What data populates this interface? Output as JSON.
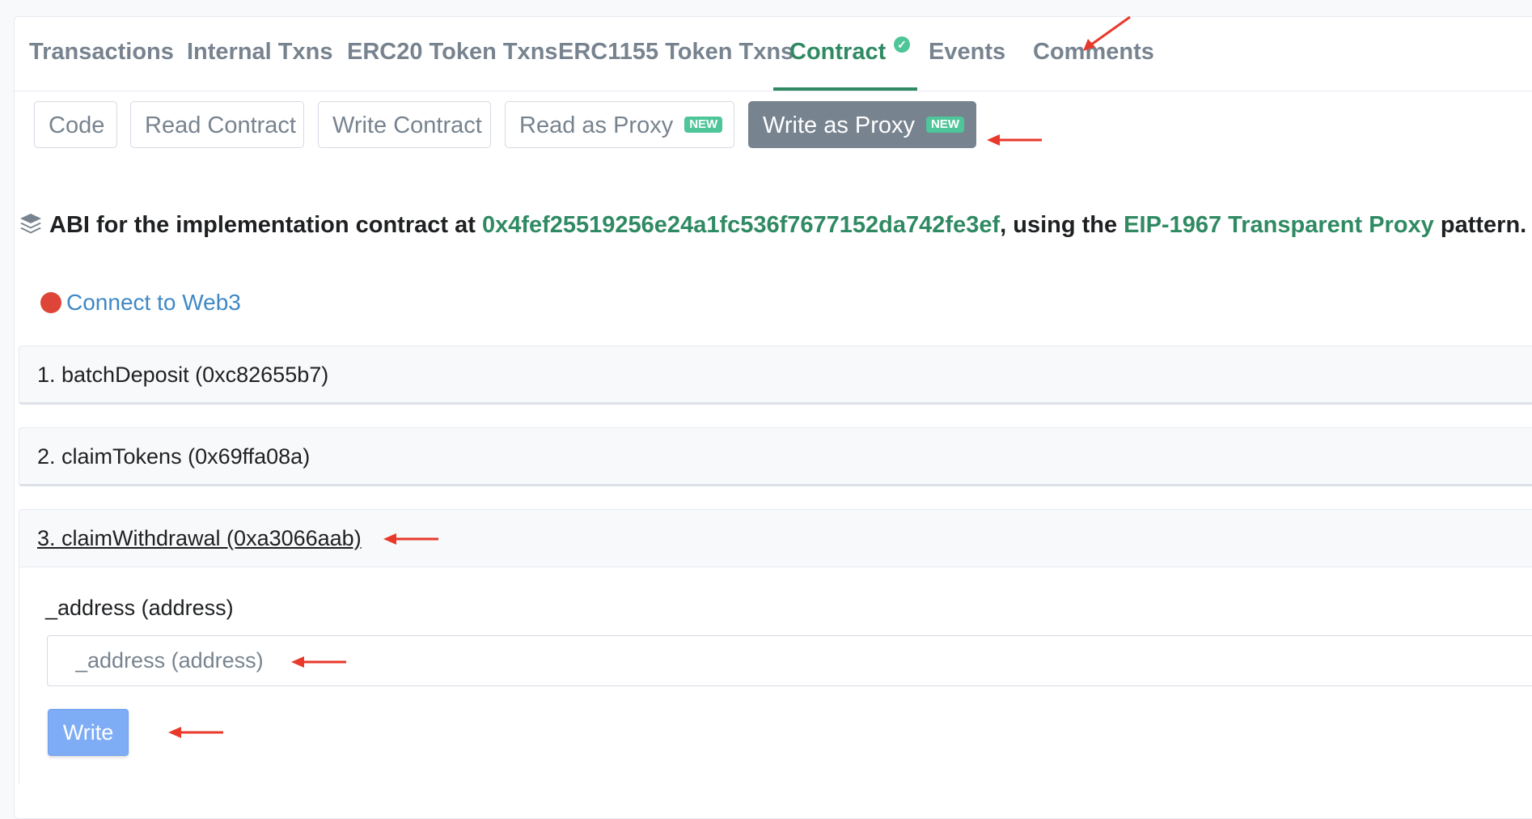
{
  "tabs": [
    {
      "label": "Transactions"
    },
    {
      "label": "Internal Txns"
    },
    {
      "label": "ERC20 Token Txns"
    },
    {
      "label": "ERC1155 Token Txns"
    },
    {
      "label": "Contract",
      "active": true,
      "verified_icon": "check-circle-icon"
    },
    {
      "label": "Events"
    },
    {
      "label": "Comments"
    }
  ],
  "subtabs": [
    {
      "label": "Code"
    },
    {
      "label": "Read Contract"
    },
    {
      "label": "Write Contract"
    },
    {
      "label": "Read as Proxy",
      "badge": "NEW"
    },
    {
      "label": "Write as Proxy",
      "badge": "NEW",
      "active": true
    }
  ],
  "abi": {
    "prefix": "ABI for the implementation contract at ",
    "address": "0x4fef25519256e24a1fc536f7677152da742fe3ef",
    "middle": ", using the ",
    "pattern_link": "EIP-1967 Transparent Proxy",
    "suffix": " pattern.",
    "icon": "layers-icon"
  },
  "web3": {
    "label": "Connect to Web3",
    "status_color": "#de4437"
  },
  "functions": [
    {
      "label": "1. batchDeposit (0xc82655b7)"
    },
    {
      "label": "2. claimTokens (0x69ffa08a)"
    },
    {
      "label": "3. claimWithdrawal (0xa3066aab)",
      "expanded": true,
      "inputs": [
        {
          "label": "_address (address)",
          "placeholder": "_address (address)",
          "value": ""
        }
      ],
      "button": "Write"
    }
  ],
  "colors": {
    "accent": "#2f8a63",
    "badge": "#4fc59a",
    "annotation": "#e8392b",
    "write_button": "#7fadf5"
  }
}
